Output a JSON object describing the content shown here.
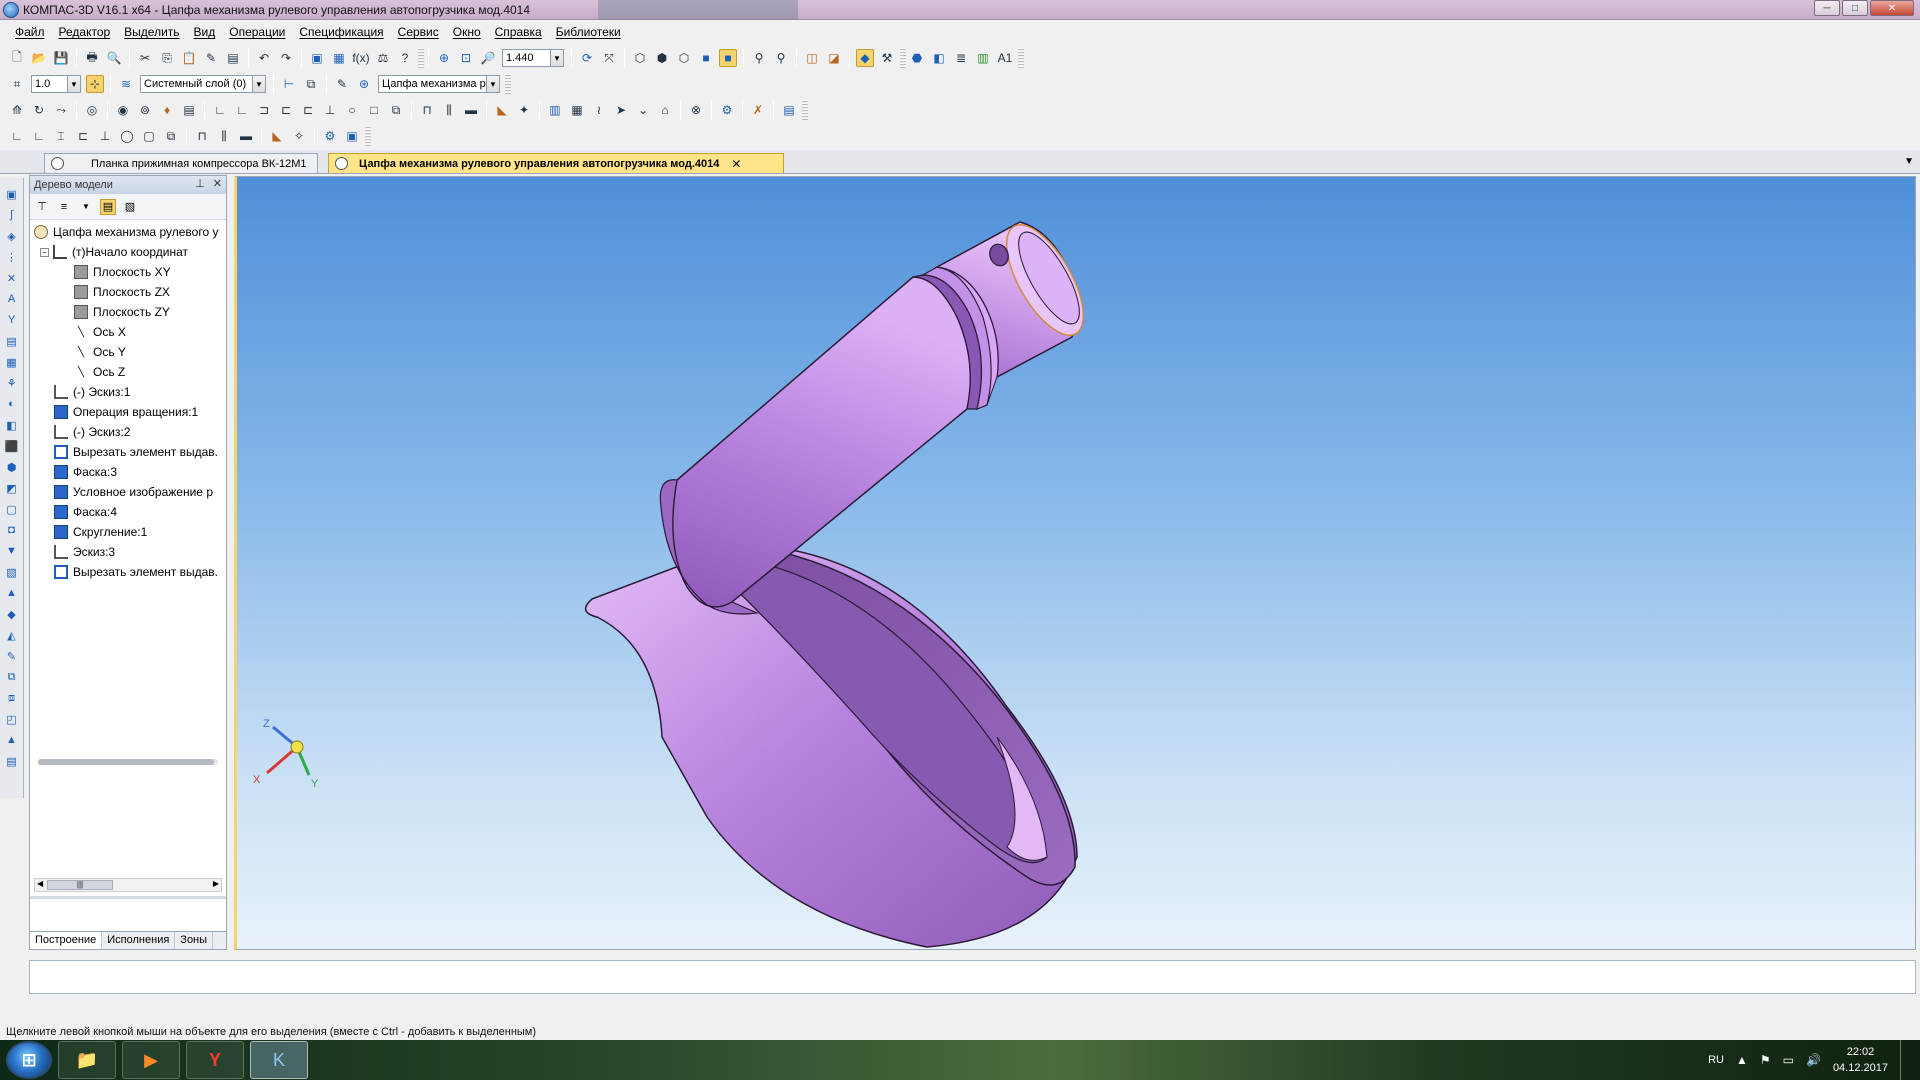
{
  "window": {
    "title": "КОМПАС-3D V16.1 x64 - Цапфа механизма рулевого управления автопогрузчика мод.4014",
    "minimize": "─",
    "maximize": "□",
    "close": "✕"
  },
  "menu": [
    "Файл",
    "Редактор",
    "Выделить",
    "Вид",
    "Операции",
    "Спецификация",
    "Сервис",
    "Окно",
    "Справка",
    "Библиотеки"
  ],
  "toolbar": {
    "zoom_value": "1.440",
    "step_value": "1.0",
    "layer_value": "Системный слой (0)",
    "document_combo": "Цапфа механизма р"
  },
  "doc_tabs": [
    {
      "label": "Планка прижимная компрессора ВК-12М1",
      "active": false
    },
    {
      "label": "Цапфа механизма рулевого управления автопогрузчика мод.4014",
      "active": true,
      "close": "✕"
    }
  ],
  "tree_panel": {
    "title": "Дерево модели",
    "pin": "⊥",
    "close": "✕",
    "nodes": [
      {
        "label": "Цапфа механизма рулевого у",
        "icon": "part-icon"
      },
      {
        "label": "(т)Начало координат",
        "icon": "origin-icon",
        "expander": "−"
      },
      {
        "label": "Плоскость XY",
        "icon": "plane-icon"
      },
      {
        "label": "Плоскость ZX",
        "icon": "plane-icon"
      },
      {
        "label": "Плоскость ZY",
        "icon": "plane-icon"
      },
      {
        "label": "Ось X",
        "icon": "axis-icon"
      },
      {
        "label": "Ось Y",
        "icon": "axis-icon"
      },
      {
        "label": "Ось Z",
        "icon": "axis-icon"
      },
      {
        "label": "(-) Эскиз:1",
        "icon": "sketch-icon"
      },
      {
        "label": "Операция вращения:1",
        "icon": "revolve-icon"
      },
      {
        "label": "(-) Эскиз:2",
        "icon": "sketch-icon"
      },
      {
        "label": "Вырезать элемент выдав.",
        "icon": "cut-extrude-icon"
      },
      {
        "label": "Фаска:3",
        "icon": "chamfer-icon"
      },
      {
        "label": "Условное изображение р",
        "icon": "thread-icon"
      },
      {
        "label": "Фаска:4",
        "icon": "chamfer-icon"
      },
      {
        "label": "Скругление:1",
        "icon": "fillet-icon"
      },
      {
        "label": "Эскиз:3",
        "icon": "sketch-icon"
      },
      {
        "label": "Вырезать элемент выдав.",
        "icon": "cut-extrude-icon"
      }
    ],
    "tabs": [
      "Построение",
      "Исполнения",
      "Зоны"
    ]
  },
  "viewport": {
    "axis_labels": {
      "x": "X",
      "y": "Y",
      "z": "Z"
    },
    "part_color": "#b27ad6"
  },
  "status": {
    "hint": "Щелкните левой кнопкой мыши на объекте для его выделения (вместе с Ctrl - добавить к выделенным)"
  },
  "taskbar": {
    "language": "RU",
    "time": "22:02",
    "date": "04.12.2017"
  }
}
